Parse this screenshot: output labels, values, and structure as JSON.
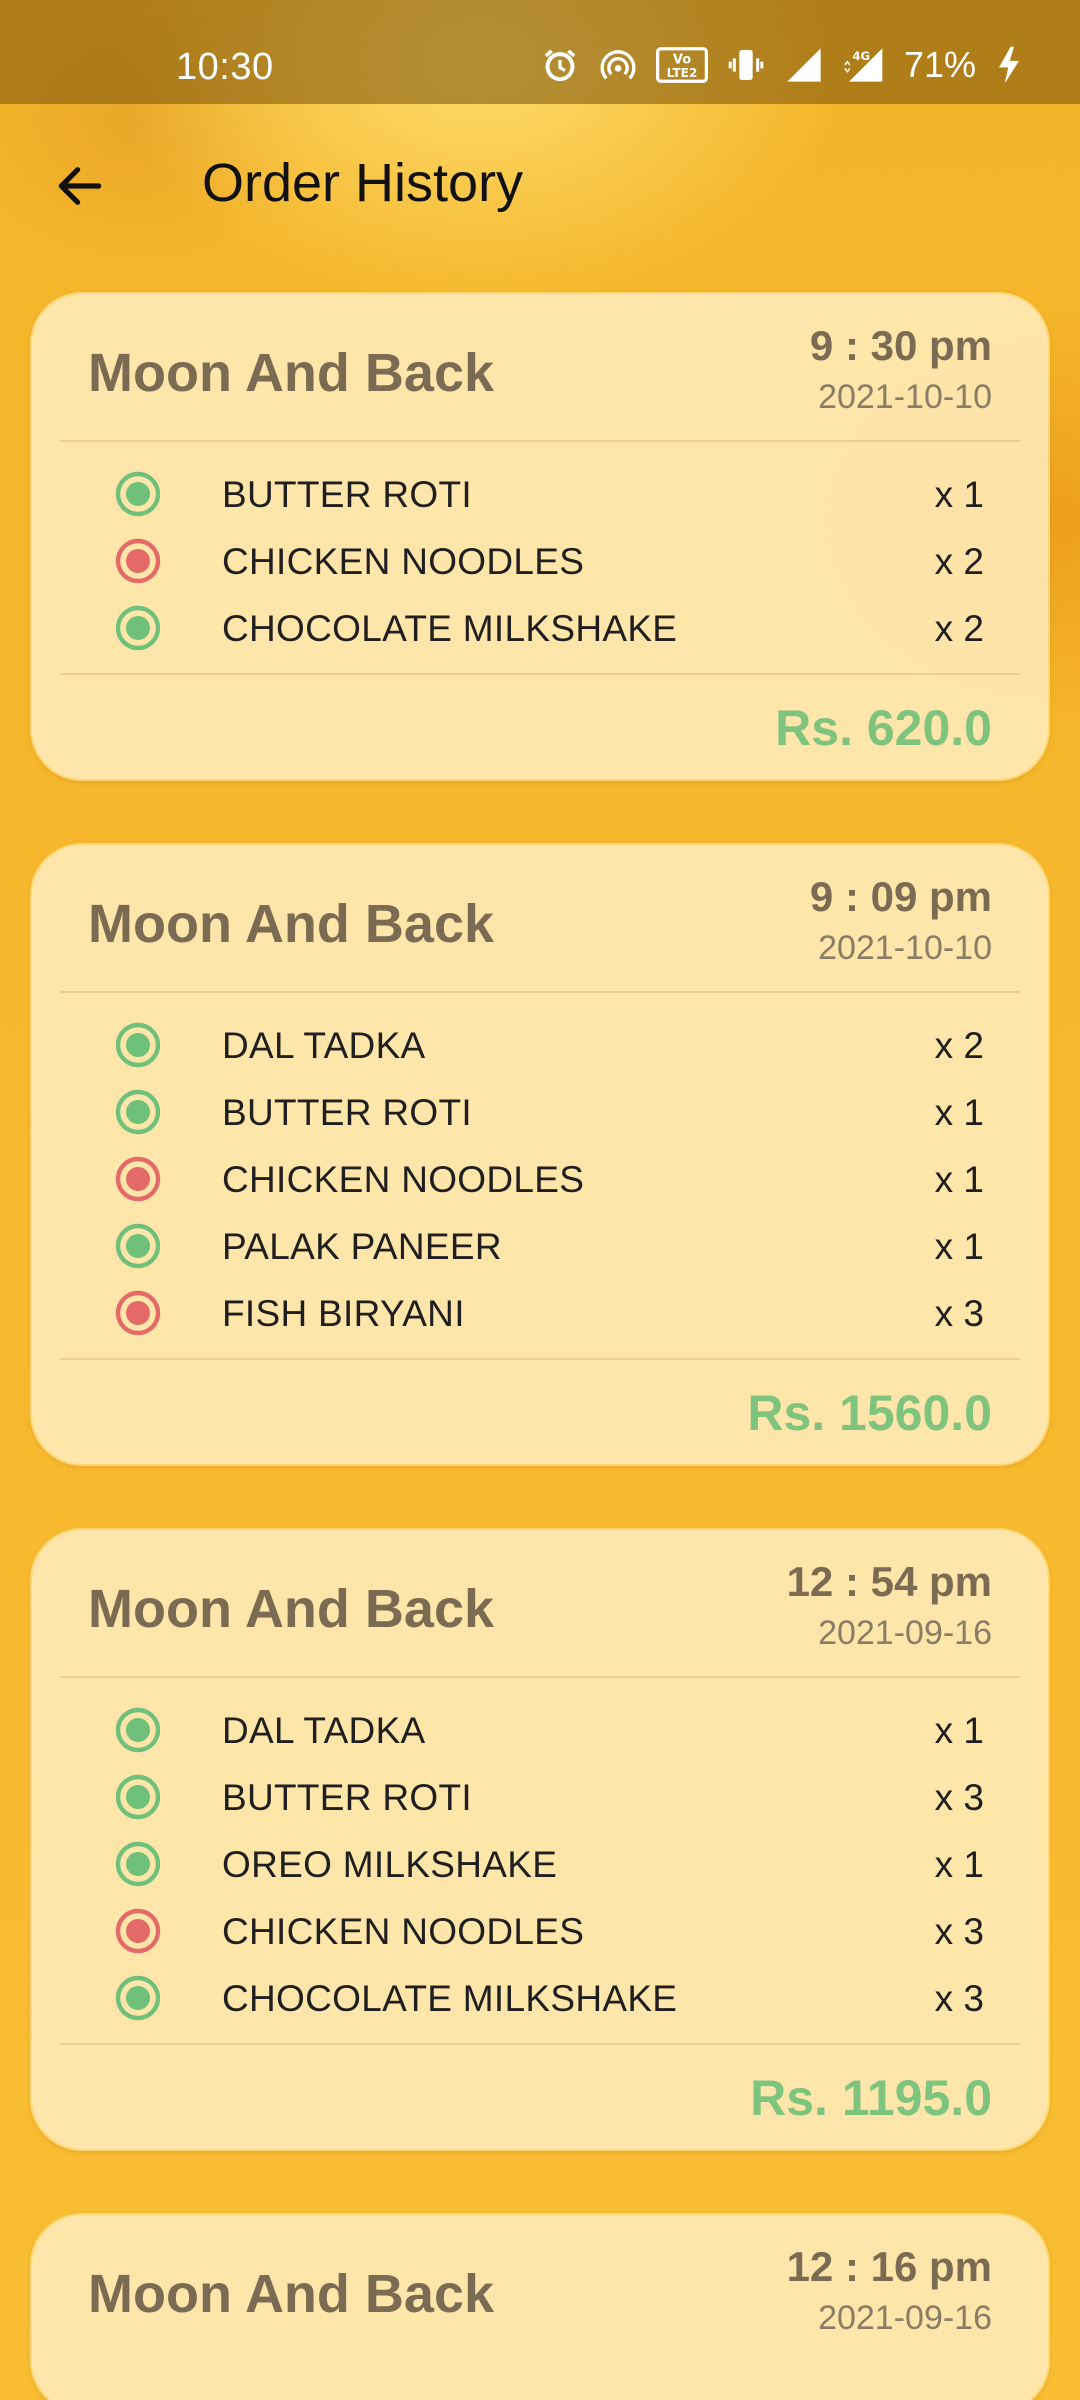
{
  "status_bar": {
    "time": "10:30",
    "battery_percent": "71%",
    "network_label": "4G",
    "volte_label": "VoLTE 2",
    "icons": [
      "alarm-icon",
      "hotspot-icon",
      "volte-icon",
      "vibrate-icon",
      "signal-icon",
      "signal-4g-icon",
      "battery-charging-icon"
    ]
  },
  "app_bar": {
    "title": "Order History",
    "back_icon": "arrow-left-icon"
  },
  "colors": {
    "veg": "#6fc07a",
    "non_veg": "#e46a6a",
    "total": "#7fc47e",
    "accent": "#f7b72c"
  },
  "orders": [
    {
      "restaurant": "Moon And Back",
      "time": "9 : 30 pm",
      "date": "2021-10-10",
      "items": [
        {
          "name": "BUTTER ROTI",
          "qty": "x 1",
          "type": "veg"
        },
        {
          "name": "CHICKEN NOODLES",
          "qty": "x 2",
          "type": "non_veg"
        },
        {
          "name": "CHOCOLATE MILKSHAKE",
          "qty": "x 2",
          "type": "veg"
        }
      ],
      "total": "Rs. 620.0"
    },
    {
      "restaurant": "Moon And Back",
      "time": "9 : 09 pm",
      "date": "2021-10-10",
      "items": [
        {
          "name": "DAL TADKA",
          "qty": "x 2",
          "type": "veg"
        },
        {
          "name": "BUTTER ROTI",
          "qty": "x 1",
          "type": "veg"
        },
        {
          "name": "CHICKEN NOODLES",
          "qty": "x 1",
          "type": "non_veg"
        },
        {
          "name": "PALAK PANEER",
          "qty": "x 1",
          "type": "veg"
        },
        {
          "name": "FISH BIRYANI",
          "qty": "x 3",
          "type": "non_veg"
        }
      ],
      "total": "Rs. 1560.0"
    },
    {
      "restaurant": "Moon And Back",
      "time": "12 : 54 pm",
      "date": "2021-09-16",
      "items": [
        {
          "name": "DAL TADKA",
          "qty": "x 1",
          "type": "veg"
        },
        {
          "name": "BUTTER ROTI",
          "qty": "x 3",
          "type": "veg"
        },
        {
          "name": "OREO MILKSHAKE",
          "qty": "x 1",
          "type": "veg"
        },
        {
          "name": "CHICKEN NOODLES",
          "qty": "x 3",
          "type": "non_veg"
        },
        {
          "name": "CHOCOLATE MILKSHAKE",
          "qty": "x 3",
          "type": "veg"
        }
      ],
      "total": "Rs. 1195.0"
    },
    {
      "restaurant": "Moon And Back",
      "time": "12 : 16 pm",
      "date": "2021-09-16",
      "items": [],
      "total": ""
    }
  ]
}
